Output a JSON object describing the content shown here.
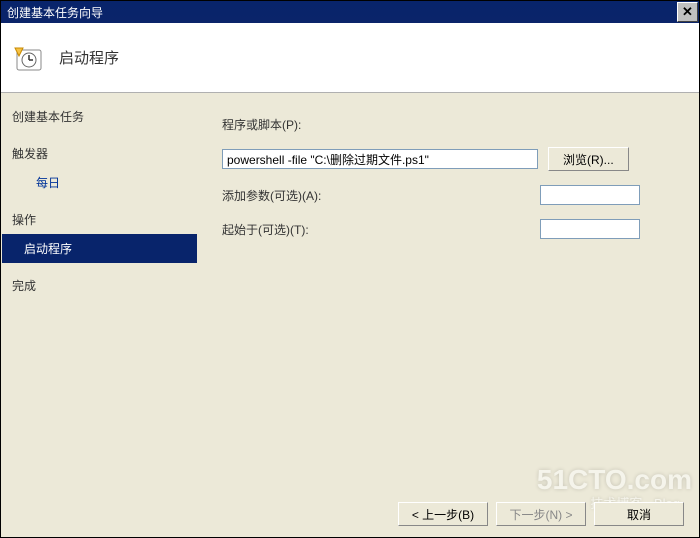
{
  "titlebar": {
    "title": "创建基本任务向导",
    "close_glyph": "✕"
  },
  "header": {
    "title": "启动程序"
  },
  "sidebar": {
    "items": [
      {
        "label": "创建基本任务",
        "type": "head"
      },
      {
        "label": "触发器",
        "type": "head"
      },
      {
        "label": "每日",
        "type": "sub"
      },
      {
        "label": "操作",
        "type": "head"
      },
      {
        "label": "启动程序",
        "type": "sel"
      },
      {
        "label": "完成",
        "type": "head"
      }
    ]
  },
  "form": {
    "program_label": "程序或脚本(P):",
    "program_value": "powershell -file \"C:\\删除过期文件.ps1\"",
    "browse_label": "浏览(R)...",
    "arguments_label": "添加参数(可选)(A):",
    "arguments_value": "",
    "startin_label": "起始于(可选)(T):",
    "startin_value": ""
  },
  "buttons": {
    "back": "< 上一步(B)",
    "next": "下一步(N) >",
    "cancel": "取消"
  },
  "watermark": {
    "main": "51CTO.com",
    "sub": "技术博客 · Blog"
  }
}
